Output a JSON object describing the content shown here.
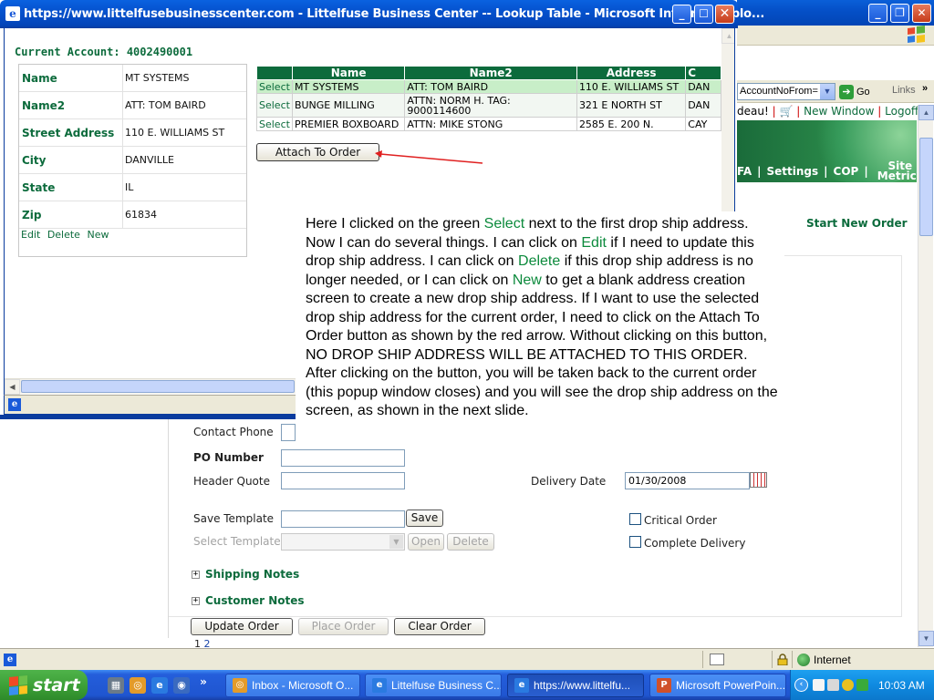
{
  "background_window": {
    "address_fragment": "AccountNoFrom=",
    "go_label": "Go",
    "links_label": "Links",
    "top_links": {
      "prefix": "deau!",
      "new_window": "New Window",
      "logoff": "Logoff"
    },
    "nav": {
      "fa": "FA",
      "settings": "Settings",
      "cop": "COP",
      "site_metrics_1": "Site",
      "site_metrics_2": "Metrics"
    },
    "start_new_order": "Start New Order"
  },
  "order_form": {
    "contact_phone_label": "Contact Phone",
    "po_number_label": "PO Number",
    "header_quote_label": "Header Quote",
    "delivery_date_label": "Delivery Date",
    "delivery_date_value": "01/30/2008",
    "save_template_label": "Save Template",
    "save_button": "Save",
    "select_template_label": "Select Template",
    "open_button": "Open",
    "delete_button": "Delete",
    "critical_order_label": "Critical Order",
    "complete_delivery_label": "Complete Delivery",
    "shipping_notes": "Shipping Notes",
    "customer_notes": "Customer Notes",
    "update_order_button": "Update Order",
    "place_order_button": "Place Order",
    "clear_order_button": "Clear Order",
    "pager_current": "1",
    "pager_next": "2"
  },
  "popup": {
    "title": "https://www.littelfusebusinesscenter.com - Littelfuse Business Center -- Lookup Table - Microsoft Internet Explo...",
    "current_account": "Current Account: 4002490001",
    "details": [
      {
        "label": "Name",
        "value": "MT SYSTEMS"
      },
      {
        "label": "Name2",
        "value": "ATT: TOM BAIRD"
      },
      {
        "label": "Street Address",
        "value": "110 E. WILLIAMS ST"
      },
      {
        "label": "City",
        "value": "DANVILLE"
      },
      {
        "label": "State",
        "value": "IL"
      },
      {
        "label": "Zip",
        "value": "61834"
      }
    ],
    "detail_actions": {
      "edit": "Edit",
      "delete": "Delete",
      "new": "New"
    },
    "lookup_columns": [
      "",
      "Name",
      "Name2",
      "Address",
      "C"
    ],
    "lookup_rows": [
      {
        "select": "Select",
        "name": "MT SYSTEMS",
        "name2": "ATT: TOM BAIRD",
        "address": "110 E. WILLIAMS ST",
        "city": "DAN"
      },
      {
        "select": "Select",
        "name": "BUNGE MILLING",
        "name2": "ATTN: NORM H. TAG: 9000114600",
        "address": "321 E NORTH ST",
        "city": "DAN"
      },
      {
        "select": "Select",
        "name": "PREMIER BOXBOARD",
        "name2": "ATTN: MIKE STONG",
        "address": "2585 E. 200 N.",
        "city": "CAY"
      }
    ],
    "attach_button": "Attach To Order"
  },
  "callout": {
    "t1": "Here I clicked on the green ",
    "select": "Select",
    "t2": " next to the first drop ship address. Now I can do several things.  I can click on ",
    "edit": "Edit",
    "t3": " if I need to update this drop ship address.  I can click on ",
    "delete": "Delete",
    "t4": " if this drop ship address is no longer needed, or I can click on ",
    "new": "New",
    "t5": " to get a blank address creation screen to create a new drop ship address.  If I want to use the selected drop ship address for the current order, I need to click on the Attach To Order button as shown by the red arrow.  Without clicking on this button, NO DROP SHIP ADDRESS WILL BE ATTACHED TO THIS ORDER.  After clicking on the button, you will be taken back to the current order (this popup window closes) and you will see the drop ship address on the screen, as shown in the next slide."
  },
  "status_bar": {
    "zone": "Internet"
  },
  "taskbar": {
    "start_label": "start",
    "tasks": [
      {
        "label": "Inbox - Microsoft O..."
      },
      {
        "label": "Littelfuse Business C..."
      },
      {
        "label": "https://www.littelfu..."
      },
      {
        "label": "Microsoft PowerPoin..."
      }
    ],
    "clock": "10:03 AM"
  },
  "colors": {
    "accent_green": "#0c6b3c",
    "select_row": "#c8eec8",
    "arrow": "#e02020",
    "xp_blue": "#245edb"
  }
}
